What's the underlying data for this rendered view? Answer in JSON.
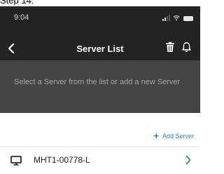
{
  "caption": "Step 14:",
  "status_bar": {
    "time": "9:04"
  },
  "header": {
    "title": "Server List"
  },
  "banner": {
    "text": "Select a Server from the list or add a new Server"
  },
  "actions": {
    "add_server_label": "Add Server"
  },
  "servers": [
    {
      "name": "MHT1-00778-L"
    }
  ],
  "colors": {
    "header_bg": "#232323",
    "banner_bg": "#444444",
    "accent": "#2f7fc4"
  },
  "icons": {
    "back": "chevron-left-icon",
    "delete": "trash-icon",
    "notifications": "bell-icon",
    "add": "plus-icon",
    "server": "monitor-icon",
    "open": "chevron-right-icon"
  }
}
